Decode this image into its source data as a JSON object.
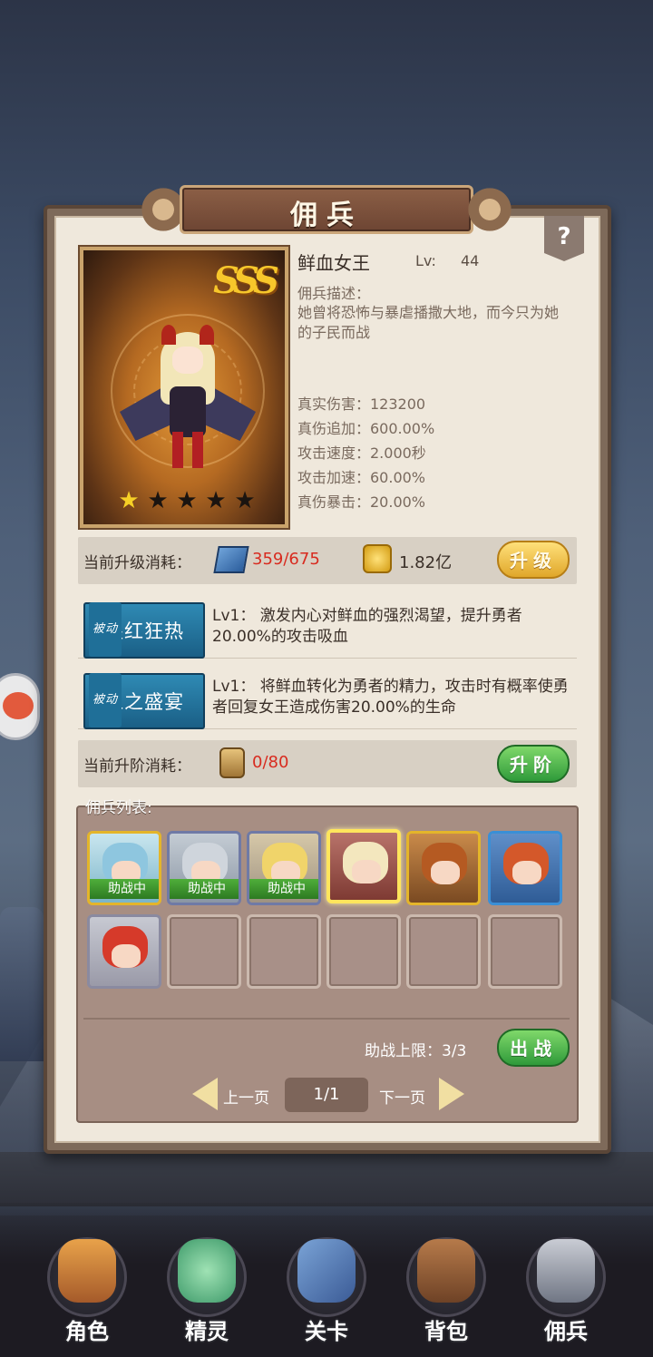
{
  "title": "佣兵",
  "help_label": "?",
  "hero": {
    "rank": "SSS",
    "name": "鲜血女王",
    "level_label": "Lv:",
    "level_value": "44",
    "stars_total": 5,
    "stars_filled": 1,
    "desc_label": "佣兵描述：",
    "desc_text": "她曾将恐怖与暴虐播撒大地，而今只为她的子民而战",
    "stats": [
      "真实伤害：123200",
      "真伤追加：600.00%",
      "攻击速度：2.000秒",
      "攻击加速：60.00%",
      "真伤暴击：20.00%"
    ]
  },
  "upgrade": {
    "label": "当前升级消耗：",
    "book_value": "359/675",
    "gold_value": "1.82亿",
    "button_label": "升级"
  },
  "skills": [
    {
      "tag": "被动",
      "name": "猩红狂热",
      "desc": "Lv1：  激发内心对鲜血的强烈渴望，提升勇者20.00%的攻击吸血"
    },
    {
      "tag": "被动",
      "name": "血之盛宴",
      "desc": "Lv1：  将鲜血转化为勇者的精力，攻击时有概率使勇者回复女王造成伤害20.00%的生命"
    }
  ],
  "advance": {
    "label": "当前升阶消耗：",
    "value": "0/80",
    "button_label": "升阶"
  },
  "list": {
    "label": "佣兵列表:",
    "assist_badge": "助战中",
    "limit_label": "助战上限：3/3",
    "deploy_button": "出战",
    "prev_label": "上一页",
    "next_label": "下一页",
    "page": "1/1"
  },
  "nav": [
    {
      "label": "角色",
      "icon": "warrior-portrait-icon"
    },
    {
      "label": "精灵",
      "icon": "slime-spirit-icon"
    },
    {
      "label": "关卡",
      "icon": "crossed-swords-icon"
    },
    {
      "label": "背包",
      "icon": "backpack-icon"
    },
    {
      "label": "佣兵",
      "icon": "knight-helmet-icon"
    }
  ],
  "colors": {
    "panel_bg": "#efe8dc",
    "red_value": "#d82b1f",
    "skill_blue": "#1a5f86",
    "green_button": "#2f9a3a",
    "gold_button": "#e0a72a"
  }
}
